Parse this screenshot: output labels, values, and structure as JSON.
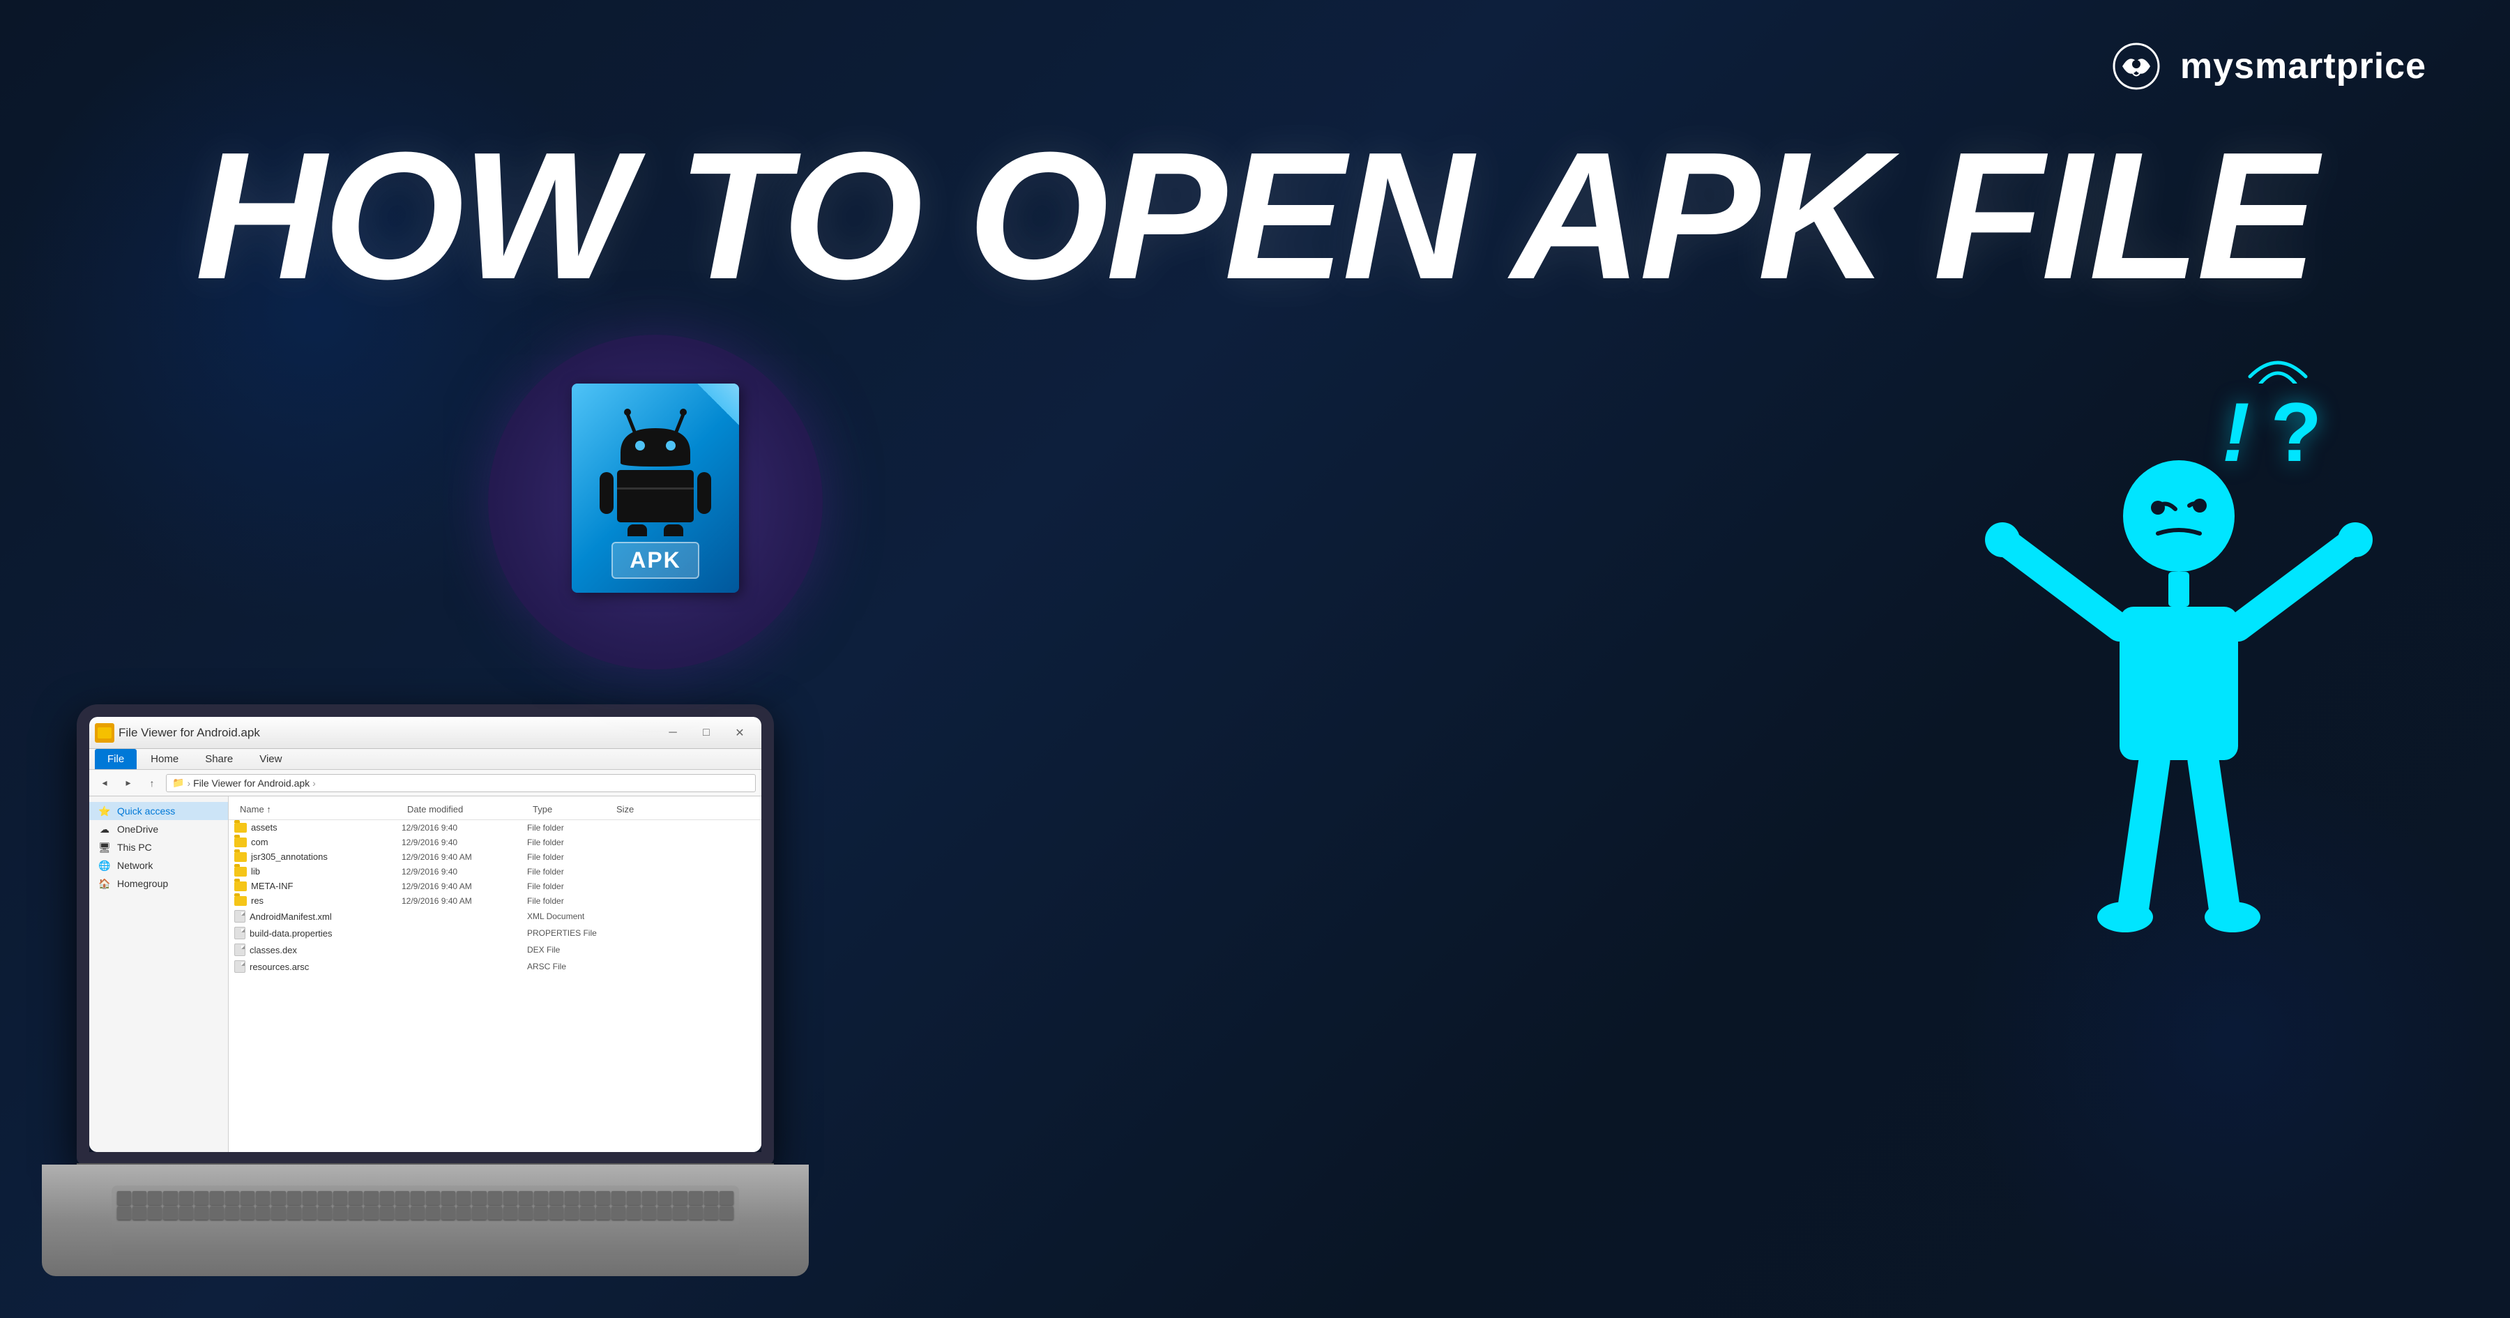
{
  "brand": {
    "name": "mysmartprice",
    "logo_alt": "mysmartprice logo"
  },
  "title": "HOW TO OPEN APK FILE",
  "explorer": {
    "window_title": "File Viewer for Android.apk",
    "ribbon_tabs": [
      "File",
      "Home",
      "Share",
      "View"
    ],
    "active_tab": "File",
    "address_path": "File Viewer for Android.apk",
    "sidebar": {
      "items": [
        {
          "name": "Quick access",
          "icon": "star",
          "active": true
        },
        {
          "name": "OneDrive",
          "icon": "cloud",
          "active": false
        },
        {
          "name": "This PC",
          "icon": "computer",
          "active": false
        },
        {
          "name": "Network",
          "icon": "network",
          "active": false
        },
        {
          "name": "Homegroup",
          "icon": "home",
          "active": false
        }
      ]
    },
    "columns": [
      "Name",
      "Date modified",
      "Type",
      "Size"
    ],
    "files": [
      {
        "name": "assets",
        "date": "12/9/2016 9:40",
        "type": "File folder",
        "size": "",
        "is_folder": true
      },
      {
        "name": "com",
        "date": "12/9/2016 9:40",
        "type": "File folder",
        "size": "",
        "is_folder": true
      },
      {
        "name": "jsr305_annotations",
        "date": "12/9/2016 9:40 AM",
        "type": "File folder",
        "size": "",
        "is_folder": true
      },
      {
        "name": "lib",
        "date": "12/9/2016 9:40",
        "type": "File folder",
        "size": "",
        "is_folder": true
      },
      {
        "name": "META-INF",
        "date": "12/9/2016 9:40 AM",
        "type": "File folder",
        "size": "",
        "is_folder": true
      },
      {
        "name": "res",
        "date": "12/9/2016 9:40 AM",
        "type": "File folder",
        "size": "",
        "is_folder": true
      },
      {
        "name": "AndroidManifest.xml",
        "date": "",
        "type": "XML Document",
        "size": "",
        "is_folder": false
      },
      {
        "name": "build-data.properties",
        "date": "",
        "type": "PROPERTIES File",
        "size": "",
        "is_folder": false
      },
      {
        "name": "classes.dex",
        "date": "",
        "type": "DEX File",
        "size": "",
        "is_folder": false
      },
      {
        "name": "resources.arsc",
        "date": "",
        "type": "ARSC File",
        "size": "",
        "is_folder": false
      }
    ]
  },
  "apk_icon": {
    "label": "APK"
  },
  "question_marks": {
    "text": "!?"
  },
  "colors": {
    "background_dark": "#0a1628",
    "accent_cyan": "#00e5ff",
    "windows_blue": "#0078d7",
    "folder_yellow": "#f5c518"
  }
}
